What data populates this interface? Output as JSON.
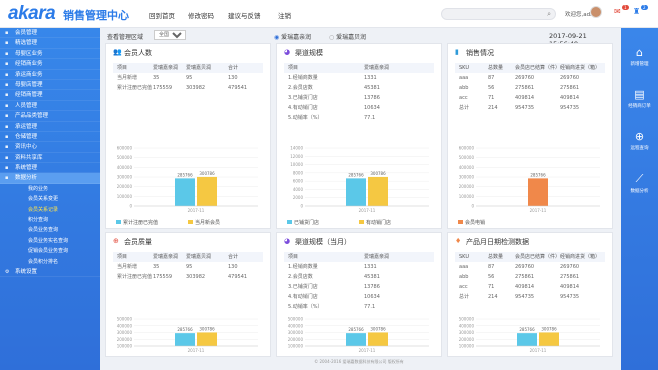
{
  "app": {
    "logo": "akara",
    "title": "销售管理中心"
  },
  "topnav": [
    "回到首页",
    "修改密码",
    "建议与反馈",
    "注销"
  ],
  "search": {
    "placeholder": ""
  },
  "user": {
    "welcome": "欢迎您,admin",
    "mail_count": "1",
    "bell_count": "2"
  },
  "colors": {
    "blue": "#5bc8e8",
    "yellow": "#f5c842",
    "orange": "#f0884a",
    "primary": "#2f6fd9"
  },
  "sidebar": {
    "items": [
      {
        "icon": "user-icon",
        "label": "会员管理"
      },
      {
        "icon": "list-icon",
        "label": "精选管理"
      },
      {
        "icon": "box-icon",
        "label": "母婴区业务"
      },
      {
        "icon": "cart-icon",
        "label": "经销商业务"
      },
      {
        "icon": "cart-icon",
        "label": "承运商业务"
      },
      {
        "icon": "shop-icon",
        "label": "母婴店管理"
      },
      {
        "icon": "chain-icon",
        "label": "经销商管理"
      },
      {
        "icon": "person-icon",
        "label": "人员管理"
      },
      {
        "icon": "product-icon",
        "label": "产品品类管理"
      },
      {
        "icon": "truck-icon",
        "label": "承运管理"
      },
      {
        "icon": "warehouse-icon",
        "label": "仓储管理"
      },
      {
        "icon": "card-icon",
        "label": "资讯中心"
      },
      {
        "icon": "doc-icon",
        "label": "资料共享库"
      },
      {
        "icon": "gear-icon",
        "label": "系统管理"
      },
      {
        "icon": "chart-icon",
        "label": "数据分析"
      }
    ],
    "subitems": [
      "我的业务",
      "会员关系变更",
      "会员关系记录",
      "积分查询",
      "会员业务查询",
      "会员业务实名查询",
      "促销会员业务查询",
      "会员积分排名"
    ],
    "footer_item": {
      "icon": "gear-icon",
      "label": "系统设置"
    }
  },
  "toolbar": {
    "label": "查看管理区域",
    "select_value": "全国",
    "radio1": "爱瑞嘉亲润",
    "radio2": "爱瑞嘉贝润",
    "datetime": "2017-09-21 15:56:49"
  },
  "panels": {
    "members": {
      "title": "会员人数",
      "icon": "users-icon",
      "headers": [
        "项目",
        "爱瑞嘉亲润",
        "爱瑞嘉贝润",
        "合计"
      ],
      "rows": [
        [
          "当月新增",
          "35",
          "95",
          "130"
        ],
        [
          "累计注册已完值",
          "175559",
          "303982",
          "479541"
        ]
      ],
      "chart": {
        "type": "bar",
        "categories": [
          "2017-11"
        ],
        "series": [
          {
            "name": "累计注册已完值",
            "values": [
              285766
            ]
          },
          {
            "name": "当月新会员",
            "values": [
              300786
            ]
          }
        ],
        "ylim": [
          0,
          600000
        ],
        "ticks": [
          "600000",
          "500000",
          "400000",
          "300000",
          "200000",
          "100000",
          "0"
        ],
        "labels": [
          "285766",
          "300786"
        ]
      }
    },
    "channel": {
      "title": "渠道规模",
      "icon": "pie-icon",
      "headers": [
        "项目",
        "爱瑞嘉亲润"
      ],
      "rows": [
        [
          "1.经销商数量",
          "1331"
        ],
        [
          "2.会员店数",
          "45381"
        ],
        [
          "3.已铺货门店",
          "13786"
        ],
        [
          "4.有动销门店",
          "10634"
        ],
        [
          "5.动销率（%）",
          "77.1"
        ]
      ],
      "chart": {
        "type": "bar",
        "categories": [
          "2017-11"
        ],
        "series": [
          {
            "name": "已铺货门店",
            "values": [
              285766
            ]
          },
          {
            "name": "有动销门店",
            "values": [
              300786
            ]
          }
        ],
        "ylim": [
          0,
          600000
        ],
        "ticks": [
          "14000",
          "12000",
          "10000",
          "8000",
          "6000",
          "4000",
          "2000",
          "0"
        ],
        "labels": [
          "285766",
          "300786"
        ]
      }
    },
    "sales": {
      "title": "销售情况",
      "icon": "bar-chart-icon",
      "headers": [
        "SKU",
        "总数量",
        "会员店已结算（件）",
        "经销商进货（箱）"
      ],
      "rows": [
        [
          "aaa",
          "87",
          "269760",
          "269760"
        ],
        [
          "abb",
          "56",
          "275861",
          "275861"
        ],
        [
          "acc",
          "71",
          "409814",
          "409814"
        ],
        [
          "总计",
          "214",
          "954735",
          "954735"
        ]
      ],
      "chart": {
        "type": "bar",
        "categories": [
          "2017-11"
        ],
        "series": [
          {
            "name": "会员电销",
            "values": [
              285766
            ]
          }
        ],
        "ylim": [
          0,
          600000
        ],
        "ticks": [
          "600000",
          "500000",
          "400000",
          "300000",
          "200000",
          "100000",
          "0"
        ],
        "labels": [
          "285766"
        ]
      }
    },
    "quality": {
      "title": "会员质量",
      "icon": "quality-icon",
      "headers": [
        "项目",
        "爱瑞嘉亲润",
        "爱瑞嘉贝润",
        "合计"
      ],
      "rows": [
        [
          "当月新增",
          "35",
          "95",
          "130"
        ],
        [
          "累计注册已完值",
          "175559",
          "303982",
          "479541"
        ]
      ],
      "chart": {
        "type": "bar",
        "categories": [
          "2017-11"
        ],
        "series": [
          {
            "name": "",
            "values": [
              285766
            ]
          },
          {
            "name": "",
            "values": [
              300786
            ]
          }
        ],
        "ylim": [
          0,
          600000
        ],
        "ticks": [
          "500000",
          "400000",
          "300000",
          "200000",
          "100000"
        ],
        "labels": [
          "285766",
          "300786"
        ]
      }
    },
    "channel_month": {
      "title": "渠道规模（当月）",
      "icon": "pie-icon",
      "headers": [
        "项目",
        "爱瑞嘉亲润"
      ],
      "rows": [
        [
          "1.经销商数量",
          "1331"
        ],
        [
          "2.会员店数",
          "45381"
        ],
        [
          "3.已铺货门店",
          "13786"
        ],
        [
          "4.有动销门店",
          "10634"
        ],
        [
          "5.动销率（%）",
          "77.1"
        ]
      ],
      "chart": {
        "type": "bar",
        "categories": [
          "2017-11"
        ],
        "series": [
          {
            "name": "",
            "values": [
              285766
            ]
          },
          {
            "name": "",
            "values": [
              300786
            ]
          }
        ],
        "ylim": [
          0,
          600000
        ],
        "ticks": [
          "500000",
          "400000",
          "300000",
          "200000",
          "100000"
        ],
        "labels": [
          "285766",
          "300786"
        ]
      }
    },
    "product": {
      "title": "产品月日期检测数据",
      "icon": "calendar-icon",
      "headers": [
        "SKU",
        "总数量",
        "会员店已结算（件）",
        "经销商进货（箱）"
      ],
      "rows": [
        [
          "aaa",
          "87",
          "269760",
          "269760"
        ],
        [
          "abb",
          "56",
          "275861",
          "275861"
        ],
        [
          "acc",
          "71",
          "409814",
          "409814"
        ],
        [
          "总计",
          "214",
          "954735",
          "954735"
        ]
      ],
      "chart": {
        "type": "bar",
        "categories": [
          "2017-11"
        ],
        "series": [
          {
            "name": "",
            "values": [
              285766
            ]
          },
          {
            "name": "",
            "values": [
              300786
            ]
          }
        ],
        "ylim": [
          0,
          600000
        ],
        "ticks": [
          "500000",
          "400000",
          "300000",
          "200000",
          "100000"
        ],
        "labels": [
          "285766",
          "300786"
        ]
      }
    }
  },
  "rightbar": [
    {
      "icon": "home-icon",
      "label": "新增管理"
    },
    {
      "icon": "clipboard-icon",
      "label": "经销商订单"
    },
    {
      "icon": "plus-circle-icon",
      "label": "远程查询"
    },
    {
      "icon": "line-chart-icon",
      "label": "数据分析"
    }
  ],
  "footer": "© 2004-2016 爱瑞嘉数据科技有限公司 版权所有"
}
